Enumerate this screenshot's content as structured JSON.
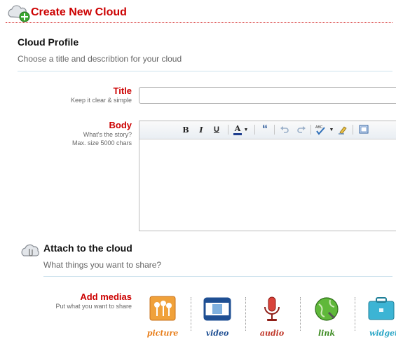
{
  "header": {
    "title": "Create New Cloud"
  },
  "profile": {
    "title": "Cloud Profile",
    "subtitle": "Choose a title and describtion for your cloud"
  },
  "fields": {
    "title_label": "Title",
    "title_hint": "Keep it clear & simple",
    "title_value": "",
    "body_label": "Body",
    "body_hint_1": "What's the story?",
    "body_hint_2": "Max. size 5000 chars"
  },
  "toolbar": {
    "bold": "B",
    "italic": "I",
    "underline": "U",
    "font_color": "A",
    "quote": "“"
  },
  "attach": {
    "title": "Attach to the cloud",
    "subtitle": "What things you want to share?"
  },
  "medias": {
    "label": "Add medias",
    "hint": "Put what you want to share",
    "items": [
      {
        "label": "picture",
        "icon": "picture-icon",
        "color": "#e87f1c"
      },
      {
        "label": "video",
        "icon": "video-icon",
        "color": "#1f4f93"
      },
      {
        "label": "audio",
        "icon": "audio-icon",
        "color": "#c0392b"
      },
      {
        "label": "link",
        "icon": "link-icon",
        "color": "#3d8b22"
      },
      {
        "label": "widget",
        "icon": "widget-icon",
        "color": "#2fa8c7"
      }
    ]
  }
}
